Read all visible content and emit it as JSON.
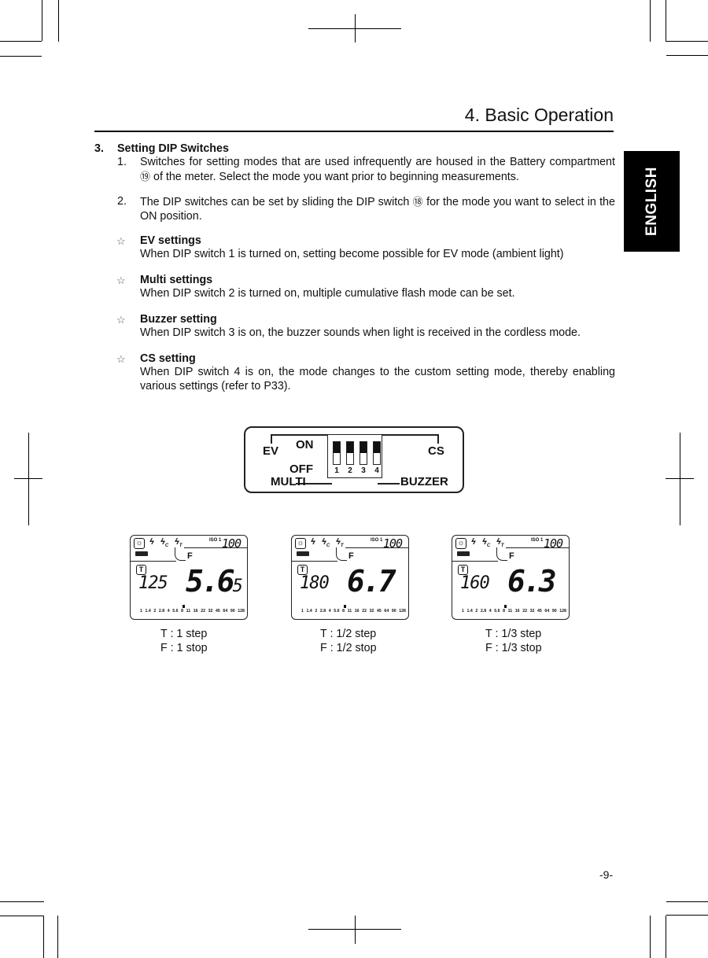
{
  "header": {
    "chapter_title": "4.  Basic Operation",
    "language_tab": "ENGLISH"
  },
  "section": {
    "number": "3.",
    "title": "Setting DIP Switches",
    "items": [
      {
        "number": "1.",
        "text": "Switches for setting modes that are used infrequently are housed in the Battery compartment",
        "ref": "⑲",
        "text_cont": " of the meter. Select the mode you want prior to beginning measurements."
      },
      {
        "number": "2.",
        "text": "The DIP switches can be set by sliding the DIP switch",
        "ref": "⑱",
        "text_cont": " for the mode you want to select in the ON position."
      }
    ],
    "bullet_glyph": "☆",
    "settings": [
      {
        "title": "EV settings",
        "text": "When DIP switch 1 is turned on, setting become possible for EV mode (ambient light)"
      },
      {
        "title": "Multi settings",
        "text": "When DIP switch 2 is turned on, multiple cumulative flash mode can be set."
      },
      {
        "title": "Buzzer setting",
        "text": "When DIP switch 3 is on, the buzzer sounds when light is received in the cordless mode."
      },
      {
        "title": "CS setting",
        "text": "When DIP switch 4 is on, the mode changes to the custom setting mode, thereby enabling various settings (refer to P33)."
      }
    ]
  },
  "dip_diagram": {
    "labels": {
      "ev": "EV",
      "on": "ON",
      "off": "OFF",
      "multi": "MULTI",
      "cs": "CS",
      "buzzer": "BUZZER"
    },
    "switches": [
      {
        "number": "1",
        "state": "off"
      },
      {
        "number": "2",
        "state": "off"
      },
      {
        "number": "3",
        "state": "off"
      },
      {
        "number": "4",
        "state": "off"
      }
    ]
  },
  "lcd_examples": [
    {
      "iso_label": "ISO 1",
      "iso_value": "100",
      "f_label": "F",
      "t_label": "T",
      "t_value": "125",
      "f_value": "5.6",
      "f_suffix": "5",
      "scale": "1 1.4 2 2.8 4 5.6 8 11 16 22 32 45 64 90 128",
      "caption_t": "T : 1 step",
      "caption_f": "F : 1 stop"
    },
    {
      "iso_label": "ISO 1",
      "iso_value": "100",
      "f_label": "F",
      "t_label": "T",
      "t_value": "180",
      "f_value": "6.7",
      "f_suffix": "",
      "scale": "1 1.4 2 2.8 4 5.6 8 11 16 22 32 45 64 90 128",
      "caption_t": "T : 1/2 step",
      "caption_f": "F : 1/2 stop"
    },
    {
      "iso_label": "ISO 1",
      "iso_value": "100",
      "f_label": "F",
      "t_label": "T",
      "t_value": "160",
      "f_value": "6.3",
      "f_suffix": "",
      "scale": "1 1.4 2 2.8 4 5.6 8 11 16 22 32 45 64 90 128",
      "caption_t": "T : 1/3 step",
      "caption_f": "F : 1/3 stop"
    }
  ],
  "lcd_icons": [
    "ambient-sun-icon",
    "flash-icon",
    "flash-cordless-icon",
    "flash-trigger-icon",
    "battery-icon"
  ],
  "footer": {
    "page_number": "-9-"
  }
}
